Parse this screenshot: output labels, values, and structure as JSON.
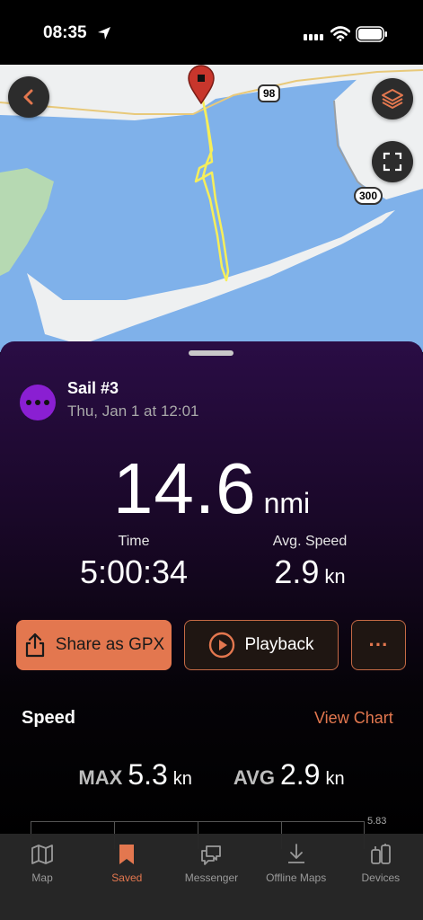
{
  "status": {
    "time": "08:35"
  },
  "map": {
    "shield_98": "98",
    "shield_300": "300"
  },
  "activity": {
    "title": "Sail #3",
    "date": "Thu, Jan 1 at 12:01"
  },
  "distance": {
    "value": "14.6",
    "unit": "nmi"
  },
  "stats": {
    "time_label": "Time",
    "time_value": "5:00:34",
    "speed_label": "Avg. Speed",
    "speed_value": "2.9",
    "speed_unit": "kn"
  },
  "actions": {
    "share_label": "Share as GPX",
    "playback_label": "Playback",
    "more_label": "···"
  },
  "speed_section": {
    "title": "Speed",
    "view_chart": "View Chart",
    "max_label": "MAX",
    "max_value": "5.3",
    "max_unit": "kn",
    "avg_label": "AVG",
    "avg_value": "2.9",
    "avg_unit": "kn",
    "chart_max_label": "5.83"
  },
  "tabs": [
    {
      "label": "Map",
      "icon": "map-icon",
      "active": false
    },
    {
      "label": "Saved",
      "icon": "bookmark-icon",
      "active": true
    },
    {
      "label": "Messenger",
      "icon": "messenger-icon",
      "active": false
    },
    {
      "label": "Offline Maps",
      "icon": "download-icon",
      "active": false
    },
    {
      "label": "Devices",
      "icon": "devices-icon",
      "active": false
    }
  ],
  "colors": {
    "accent": "#e3774f",
    "activity": "#8a1fd2",
    "water": "#7fb1ea",
    "land": "#eef0f1",
    "track": "#f6ee5a"
  }
}
